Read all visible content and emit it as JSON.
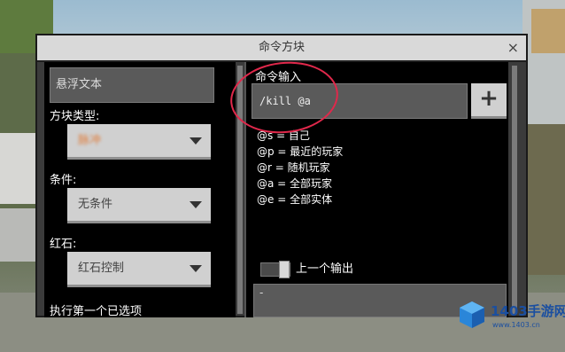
{
  "dialog": {
    "title": "命令方块",
    "close_glyph": "×"
  },
  "left": {
    "hover_text": "悬浮文本",
    "block_type_label": "方块类型:",
    "block_type_value": "脉冲",
    "condition_label": "条件:",
    "condition_value": "无条件",
    "redstone_label": "红石:",
    "redstone_value": "红石控制",
    "cut_label": "执行第一个已选项"
  },
  "right": {
    "command_label": "命令输入",
    "command_value": "/kill @a",
    "plus_label": "+",
    "selectors": [
      "@s = 自己",
      "@p = 最近的玩家",
      "@r = 随机玩家",
      "@a = 全部玩家",
      "@e = 全部实体"
    ],
    "previous_output_label": "上一个输出",
    "output_value": "-"
  },
  "watermark": {
    "name": "1403手游网",
    "url": "www.1403.cn"
  },
  "colors": {
    "annotation": "#e0284b",
    "watermark": "#1b4fa0"
  }
}
